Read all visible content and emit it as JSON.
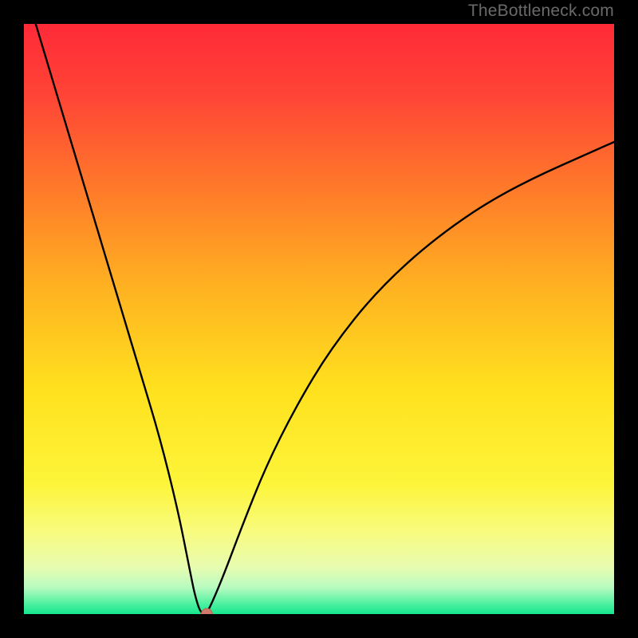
{
  "watermark": "TheBottleneck.com",
  "colors": {
    "frame": "#000000",
    "curve": "#000000",
    "marker_fill": "#cf7a6a",
    "marker_stroke": "#b85f50",
    "gradient_stops": [
      {
        "offset": 0.0,
        "color": "#ff2a38"
      },
      {
        "offset": 0.12,
        "color": "#ff4436"
      },
      {
        "offset": 0.28,
        "color": "#ff7a2a"
      },
      {
        "offset": 0.45,
        "color": "#ffb321"
      },
      {
        "offset": 0.62,
        "color": "#ffe11e"
      },
      {
        "offset": 0.78,
        "color": "#fdf53a"
      },
      {
        "offset": 0.86,
        "color": "#f8fb7e"
      },
      {
        "offset": 0.92,
        "color": "#e8fcb0"
      },
      {
        "offset": 0.955,
        "color": "#b8fbc0"
      },
      {
        "offset": 0.985,
        "color": "#45ef9d"
      },
      {
        "offset": 1.0,
        "color": "#16e78e"
      }
    ]
  },
  "chart_data": {
    "type": "line",
    "title": "",
    "xlabel": "",
    "ylabel": "",
    "xlim": [
      0,
      100
    ],
    "ylim": [
      0,
      100
    ],
    "optimum_x": 30,
    "marker": {
      "x": 31,
      "y": 0
    },
    "series": [
      {
        "name": "bottleneck-curve",
        "x": [
          2,
          5,
          8,
          11,
          14,
          17,
          20,
          23,
          26,
          28,
          29,
          30,
          31,
          32,
          34,
          37,
          41,
          46,
          52,
          60,
          70,
          82,
          100
        ],
        "y": [
          100,
          90,
          80,
          70,
          60,
          50,
          40,
          30,
          18,
          8,
          3,
          0,
          0.2,
          2.2,
          7,
          15,
          25,
          35,
          45,
          55,
          64,
          72,
          80
        ]
      }
    ]
  }
}
